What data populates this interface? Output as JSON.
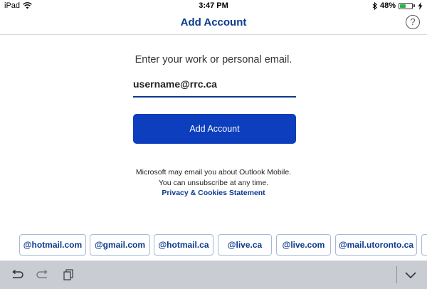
{
  "status_bar": {
    "device": "iPad",
    "time": "3:47 PM",
    "battery_percent": "48%",
    "battery_level": 0.48,
    "icons": [
      "wifi-icon",
      "bluetooth-icon",
      "battery-icon",
      "charging-bolt-icon"
    ]
  },
  "nav": {
    "title": "Add Account",
    "help_label": "?"
  },
  "form": {
    "prompt": "Enter your work or personal email.",
    "email_value": "username@rrc.ca",
    "button_label": "Add Account"
  },
  "disclaimer": {
    "line1": "Microsoft may email you about Outlook Mobile.",
    "line2": "You can unsubscribe at any time.",
    "link_label": "Privacy & Cookies Statement"
  },
  "suggestions": [
    "@hotmail.com",
    "@gmail.com",
    "@hotmail.ca",
    "@live.ca",
    "@live.com",
    "@mail.utoronto.ca"
  ],
  "keyboard_bar": {
    "icons": [
      "undo-icon",
      "redo-icon",
      "paste-icon",
      "dismiss-keyboard-icon"
    ]
  },
  "colors": {
    "accent": "#0b3a8f",
    "button": "#0c3ebd",
    "keyboard_bar": "#c9ccd2"
  }
}
